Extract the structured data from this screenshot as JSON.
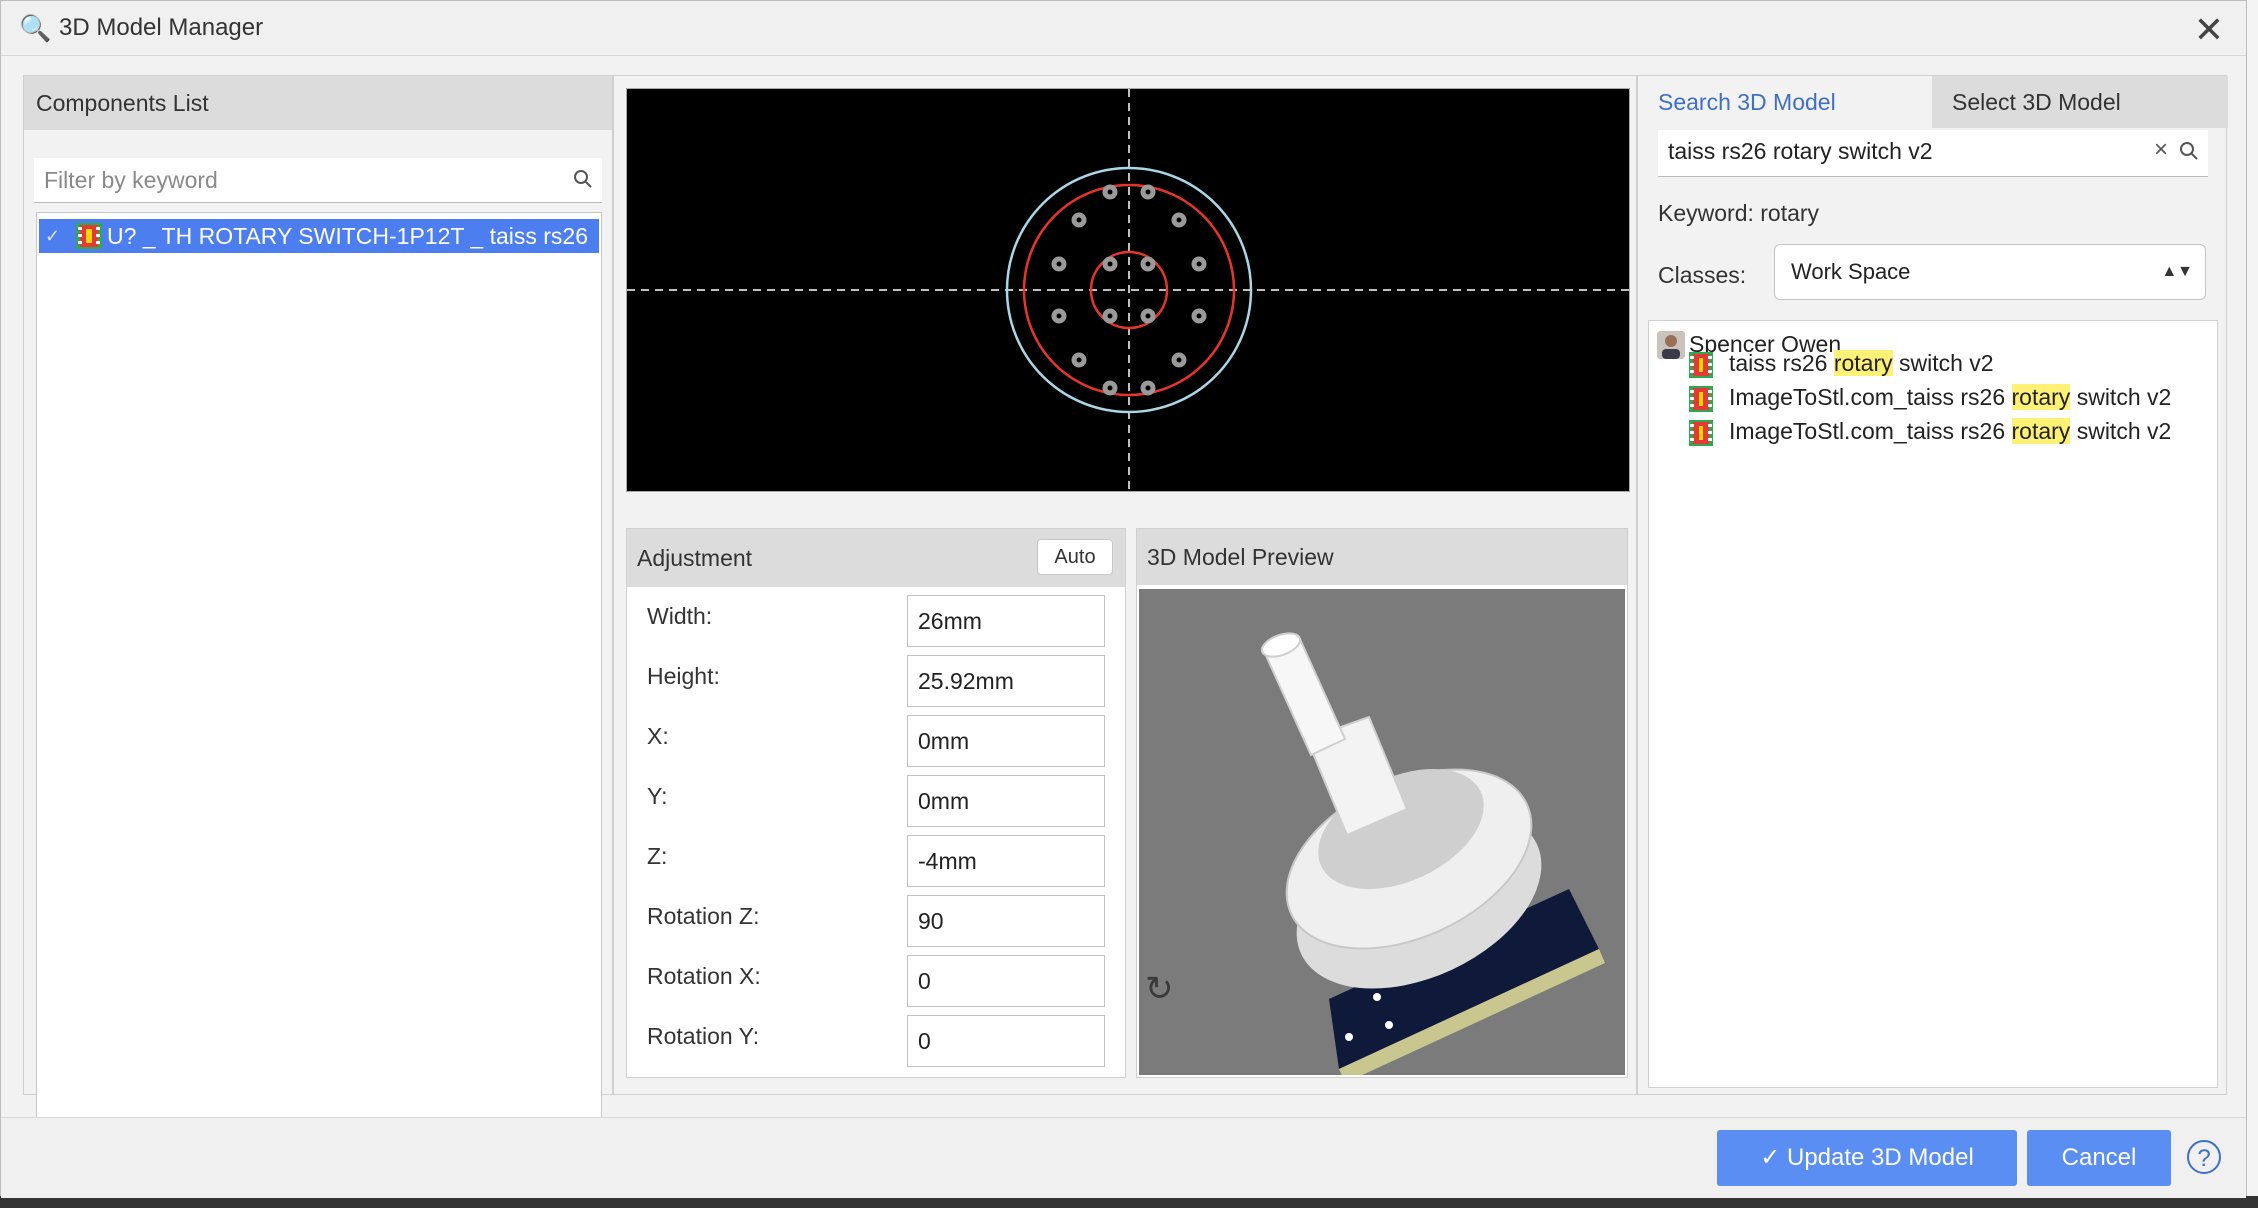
{
  "window": {
    "title": "3D Model Manager",
    "title_icon": "magnifier-icon",
    "close_icon": "close-icon"
  },
  "components": {
    "header": "Components List",
    "filter_placeholder": "Filter by keyword",
    "items": [
      {
        "label": "U? _ TH ROTARY SWITCH-1P12T _ taiss rs26",
        "checked": true,
        "selected": true
      }
    ]
  },
  "adjustment": {
    "header": "Adjustment",
    "auto_label": "Auto",
    "fields": [
      {
        "label": "Width:",
        "value": "26mm"
      },
      {
        "label": "Height:",
        "value": "25.92mm"
      },
      {
        "label": "X:",
        "value": "0mm"
      },
      {
        "label": "Y:",
        "value": "0mm"
      },
      {
        "label": "Z:",
        "value": "-4mm"
      },
      {
        "label": "Rotation Z:",
        "value": "90"
      },
      {
        "label": "Rotation X:",
        "value": "0"
      },
      {
        "label": "Rotation Y:",
        "value": "0"
      }
    ]
  },
  "preview": {
    "header": "3D Model Preview",
    "refresh_icon": "refresh-icon"
  },
  "search_panel": {
    "tabs": [
      "Search 3D Model",
      "Select 3D Model"
    ],
    "active_tab": "Search 3D Model",
    "search_value": "taiss rs26 rotary switch v2",
    "keyword_label": "Keyword: rotary",
    "classes_label": "Classes:",
    "classes_value": "Work Space",
    "highlight_word": "rotary",
    "highlight_color": "#fff176",
    "tree": {
      "user": "Spencer Owen",
      "results": [
        {
          "pre": "taiss rs26 ",
          "hl": "rotary",
          "post": " switch v2"
        },
        {
          "pre": "ImageToStl.com_taiss rs26 ",
          "hl": "rotary",
          "post": " switch v2"
        },
        {
          "pre": "ImageToStl.com_taiss rs26 ",
          "hl": "rotary",
          "post": " switch v2"
        }
      ]
    }
  },
  "footer": {
    "update_label": "Update 3D Model",
    "cancel_label": "Cancel",
    "help_label": "?"
  },
  "colors": {
    "accent": "#5b8ef2",
    "tab_active_text": "#3f6fc6",
    "selection": "#4c7ef0",
    "canvas_bg": "#000000",
    "footprint_outline": "#e8352a",
    "body_outline": "#a9d7e6"
  }
}
